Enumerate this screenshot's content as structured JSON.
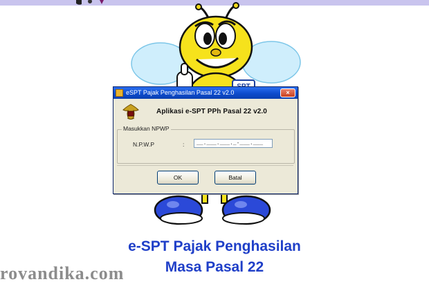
{
  "colors": {
    "top_band": "#c9c4ee",
    "caption": "#1f3fc8",
    "title_bar": "#0d4ccd",
    "dialog_bg": "#ece9d8"
  },
  "dialog": {
    "title": "eSPT Pajak Penghasilan Pasal 22 v2.0",
    "close_glyph": "×",
    "app_title": "Aplikasi e-SPT PPh Pasal 22 v2.0",
    "group_label": "Masukkan NPWP",
    "npwp_label": "N.P.W.P",
    "colon": ":",
    "npwp_value": "__.___.___._-___.___",
    "ok_label": "OK",
    "batal_label": "Batal",
    "icons": [
      "title-app-icon",
      "garuda-emblem-icon",
      "close-icon"
    ]
  },
  "caption": {
    "line1": "e-SPT Pajak Penghasilan",
    "line2": "Masa Pasal 22"
  },
  "watermark": "rovandika.com"
}
